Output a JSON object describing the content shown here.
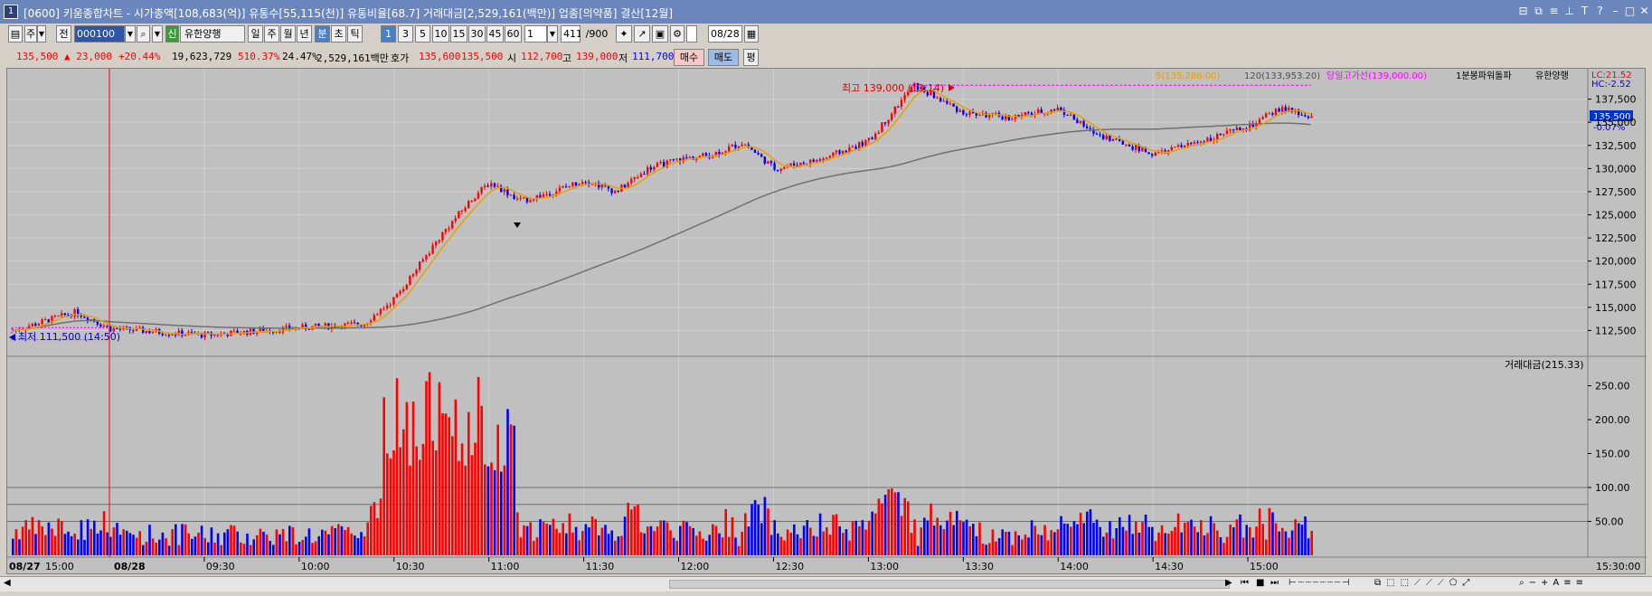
{
  "window": {
    "icon_label": "1",
    "title": "[0600] 키움종합차트 - 시가총액[108,683(억)] 유통수[55,115(천)] 유통비율[68.7] 거래대금[2,529,161(백만)] 업종[의약품] 결산[12월]"
  },
  "toolbar": {
    "period_label": "주",
    "market_label": "전",
    "code": "000100",
    "stock_badge": "신",
    "stock_name": "유한양행",
    "period_buttons": [
      "일",
      "주",
      "월",
      "년",
      "분",
      "초",
      "틱"
    ],
    "period_selected": "분",
    "interval_buttons": [
      "1",
      "3",
      "5",
      "10",
      "15",
      "30",
      "45",
      "60"
    ],
    "interval_selected": "1",
    "interval_value": "1",
    "count": "411",
    "count_total": "/900",
    "date_check_label": "D",
    "date_value": "08/28"
  },
  "quote": {
    "price": "135,500",
    "change": "▲ 23,000",
    "change_pct": "+20.44%",
    "volume": "19,623,729",
    "vol_ratio": "510.37%",
    "turnover_rate": "24.47%",
    "amount": "2,529,161백만",
    "hoga_label": "호가",
    "ask": "135,600",
    "bid": "135,500",
    "open_label": "시",
    "open": "112,700",
    "high_label": "고",
    "high": "139,000",
    "low_label": "저",
    "low": "111,700",
    "buy_tab": "매수",
    "sell_tab": "매도",
    "flat_tab": "평"
  },
  "price_pane": {
    "legend": {
      "ma5": "5(135,286.00)",
      "ma120": "120(133,953.20)",
      "high_line": "당일고가선(139,000.00)",
      "indicator": "1분봉파워돌파",
      "name": "유한양행"
    },
    "lc": "LC:21.52",
    "hc": "HC:-2.52",
    "high_annotation": "최고 139,000 (13:14)",
    "low_annotation": "최저 111,500 (14:50)",
    "current_price_tag": "135,500",
    "current_change_tag": "-0.07%",
    "y_ticks": [
      "137,500",
      "135,000",
      "132,500",
      "130,000",
      "127,500",
      "125,000",
      "122,500",
      "120,000",
      "117,500",
      "115,000",
      "112,500"
    ]
  },
  "volume_pane": {
    "legend": "거래대금(215.33)",
    "y_ticks": [
      "250.00",
      "200.00",
      "150.00",
      "100.00",
      "50.00"
    ]
  },
  "x_axis": {
    "date_prev": "08/27",
    "time_prev": "15:00",
    "date_cur": "08/28",
    "times": [
      "09:30",
      "10:00",
      "10:30",
      "11:00",
      "11:30",
      "12:00",
      "12:30",
      "13:00",
      "13:30",
      "14:00",
      "14:30",
      "15:00"
    ],
    "right_label": "15:30:00"
  },
  "chart_data": {
    "type": "candlestick+volume",
    "price_y_range": [
      110000,
      140000
    ],
    "volume_y_range": [
      0,
      280
    ],
    "price_path": [
      [
        "08/27 14:50",
        112500
      ],
      [
        "08/27 15:10",
        114500
      ],
      [
        "08/28 09:00",
        112700
      ],
      [
        "09:30",
        112000
      ],
      [
        "10:00",
        112800
      ],
      [
        "10:20",
        113200
      ],
      [
        "10:30",
        116000
      ],
      [
        "10:45",
        123000
      ],
      [
        "10:55",
        127000
      ],
      [
        "11:00",
        128500
      ],
      [
        "11:10",
        126500
      ],
      [
        "11:20",
        127500
      ],
      [
        "11:30",
        128800
      ],
      [
        "11:40",
        127500
      ],
      [
        "11:50",
        130000
      ],
      [
        "12:00",
        131000
      ],
      [
        "12:10",
        131500
      ],
      [
        "12:20",
        132800
      ],
      [
        "12:30",
        130000
      ],
      [
        "12:45",
        131000
      ],
      [
        "13:00",
        133000
      ],
      [
        "13:14",
        139000
      ],
      [
        "13:30",
        136000
      ],
      [
        "13:45",
        135500
      ],
      [
        "14:00",
        136500
      ],
      [
        "14:10",
        134000
      ],
      [
        "14:30",
        131500
      ],
      [
        "14:40",
        132500
      ],
      [
        "14:50",
        133500
      ],
      [
        "15:00",
        134500
      ],
      [
        "15:10",
        136500
      ],
      [
        "15:20",
        135500
      ]
    ]
  },
  "colors": {
    "up": "#ff0000",
    "down": "#0000ff",
    "ma5": "#e8a000",
    "ma120": "#707070",
    "high_line": "#ff00ff",
    "pane_bg": "#c0c0c0"
  }
}
